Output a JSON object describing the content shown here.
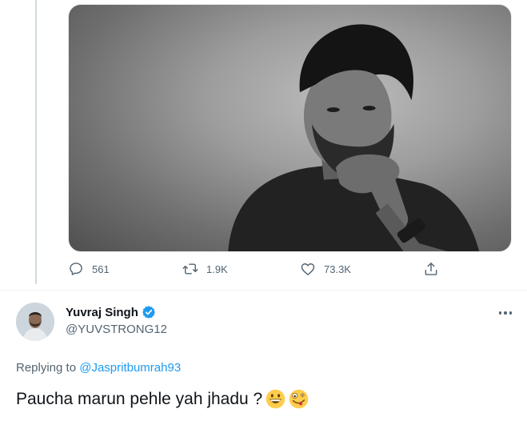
{
  "media": {
    "description_icon": "photo-image"
  },
  "actions": {
    "reply_count": "561",
    "retweet_count": "1.9K",
    "like_count": "73.3K"
  },
  "reply_tweet": {
    "display_name": "Yuvraj Singh",
    "handle": "@YUVSTRONG12",
    "replying_prefix": "Replying to ",
    "replying_to": "@Jaspritbumrah93",
    "text": "Paucha marun pehle yah jhadu ?",
    "emojis": [
      "grinning-face-emoji",
      "zany-face-emoji"
    ]
  },
  "colors": {
    "accent": "#1d9bf0",
    "secondary_text": "#536471",
    "verified_badge": "#1d9bf0"
  }
}
